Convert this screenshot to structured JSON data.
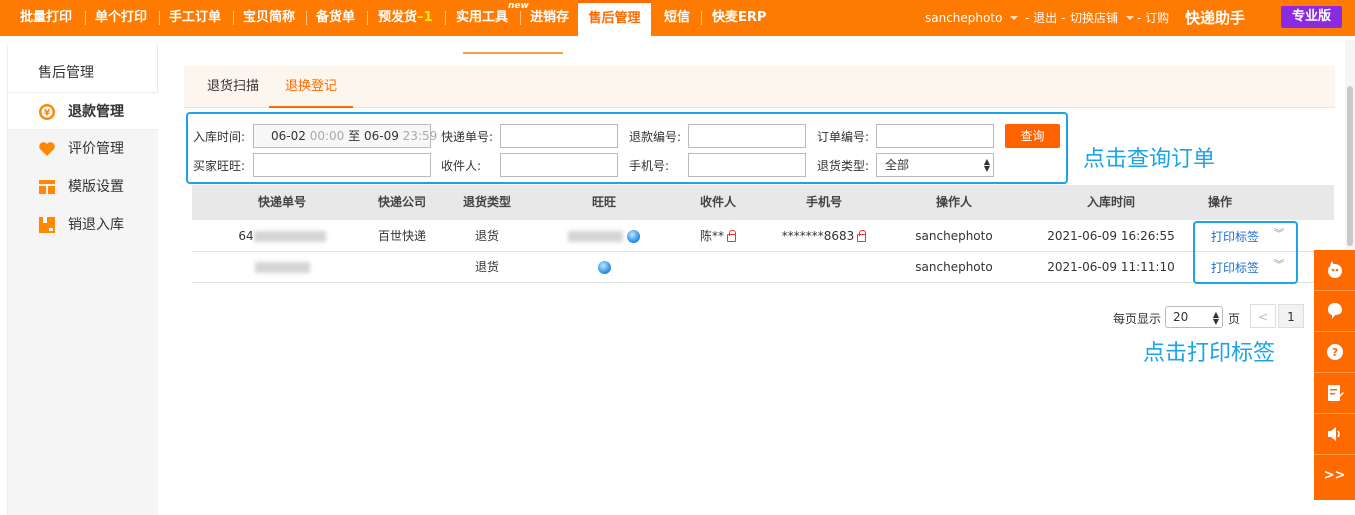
{
  "nav": {
    "items": [
      "批量打印",
      "单个打印",
      "手工订单",
      "宝贝简称",
      "备货单",
      "预发货",
      "实用工具",
      "进销存",
      "售后管理",
      "短信",
      "快麦ERP"
    ],
    "presale_suffix": "–1",
    "new_badge": "new",
    "active": "售后管理",
    "user": "sanchephoto",
    "logout": "- 退出 -",
    "switch_store": "切换店铺",
    "subscribe": "- 订购",
    "brand": "快递助手",
    "edition": "专业版"
  },
  "sidebar": {
    "title": "售后管理",
    "items": [
      {
        "label": "退款管理",
        "icon": "refund-icon",
        "active": true
      },
      {
        "label": "评价管理",
        "icon": "heart-icon",
        "active": false
      },
      {
        "label": "模版设置",
        "icon": "template-icon",
        "active": false
      },
      {
        "label": "销退入库",
        "icon": "return-stock-icon",
        "active": false
      }
    ]
  },
  "tabs": [
    "退货扫描",
    "退换登记"
  ],
  "active_tab": "退换登记",
  "filters": {
    "stock_time_label": "入库时间:",
    "date_from": "06-02",
    "time_from": "00:00",
    "date_to_sep": "至",
    "date_to": "06-09",
    "time_to": "23:59",
    "tracking_label": "快递单号:",
    "refund_no_label": "退款编号:",
    "order_no_label": "订单编号:",
    "buyer_label": "买家旺旺:",
    "receiver_label": "收件人:",
    "phone_label": "手机号:",
    "return_type_label": "退货类型:",
    "return_type_value": "全部",
    "query_button": "查询"
  },
  "annotations": {
    "query_hint": "点击查询订单",
    "print_hint": "点击打印标签"
  },
  "table": {
    "headers": [
      "快递单号",
      "快递公司",
      "退货类型",
      "旺旺",
      "收件人",
      "手机号",
      "操作人",
      "入库时间",
      "操作"
    ],
    "rows": [
      {
        "tracking": "64",
        "company": "百世快递",
        "type": "退货",
        "wangwang": "",
        "receiver": "陈**",
        "phone": "*******8683",
        "operator": "sanchephoto",
        "time": "2021-06-09 16:26:55",
        "action": "打印标签"
      },
      {
        "tracking": "",
        "company": "",
        "type": "退货",
        "wangwang": "",
        "receiver": "",
        "phone": "",
        "operator": "sanchephoto",
        "time": "2021-06-09 11:11:10",
        "action": "打印标签"
      }
    ]
  },
  "pager": {
    "per_page_label": "每页显示",
    "per_page_value": "20",
    "page_unit": "页",
    "prev": "<",
    "current": "1"
  },
  "floatbar": {
    "items": [
      "mascot-icon",
      "chat-bubble-icon",
      "help-icon",
      "edit-note-icon",
      "volume-icon"
    ],
    "expand": ">>"
  },
  "colors": {
    "accent": "#ff7a00",
    "annotation": "#1ba4e8",
    "link": "#1a6fd6",
    "edition_badge": "#8a2be2"
  }
}
